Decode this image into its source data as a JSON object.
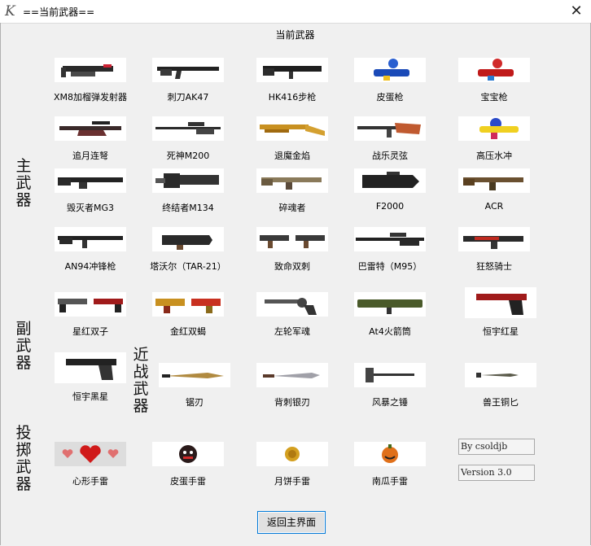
{
  "window": {
    "title": "==当前武器==",
    "icon": "k-logo-icon",
    "close_label": "✕"
  },
  "heading": "当前武器",
  "categories": {
    "primary": "主武器",
    "secondary": "副武器",
    "melee": "近战武器",
    "throwable": "投掷武器"
  },
  "primary": [
    {
      "label": "XM8加榴弹发射器",
      "icon": "grenade-launcher-rifle-icon"
    },
    {
      "label": "刺刀AK47",
      "icon": "ak47-icon"
    },
    {
      "label": "HK416步枪",
      "icon": "hk416-icon"
    },
    {
      "label": "皮蛋枪",
      "icon": "toy-gun-blue-icon"
    },
    {
      "label": "宝宝枪",
      "icon": "toy-gun-red-icon"
    },
    {
      "label": "追月连弩",
      "icon": "crossbow-icon"
    },
    {
      "label": "死神M200",
      "icon": "sniper-m200-icon"
    },
    {
      "label": "退魔金焰",
      "icon": "golden-shotgun-icon"
    },
    {
      "label": "战乐灵弦",
      "icon": "guitar-gun-icon"
    },
    {
      "label": "高压水冲",
      "icon": "water-gun-icon"
    },
    {
      "label": "毁灭者MG3",
      "icon": "mg3-icon"
    },
    {
      "label": "终结者M134",
      "icon": "minigun-icon"
    },
    {
      "label": "碎魂者",
      "icon": "rifle-tan-icon"
    },
    {
      "label": "F2000",
      "icon": "f2000-icon"
    },
    {
      "label": "ACR",
      "icon": "acr-icon"
    },
    {
      "label": "AN94冲锋枪",
      "icon": "an94-icon"
    },
    {
      "label": "塔沃尔（TAR-21）",
      "icon": "tar21-icon"
    },
    {
      "label": "致命双刺",
      "icon": "dual-smg-icon"
    },
    {
      "label": "巴雷特（M95）",
      "icon": "barrett-icon"
    },
    {
      "label": "狂怒骑士",
      "icon": "smg-red-icon"
    }
  ],
  "secondary": [
    {
      "label": "星红双子",
      "icon": "dual-pistol-icon"
    },
    {
      "label": "金红双蝎",
      "icon": "dual-scorpion-icon"
    },
    {
      "label": "左轮军魂",
      "icon": "revolver-icon"
    },
    {
      "label": "At4火箭筒",
      "icon": "rocket-launcher-icon"
    },
    {
      "label": "恒宇红星",
      "icon": "red-pistol-icon"
    },
    {
      "label": "恒宇黑星",
      "icon": "black-pistol-icon"
    }
  ],
  "melee": [
    {
      "label": "锯刃",
      "icon": "serrated-blade-icon"
    },
    {
      "label": "背刺银刃",
      "icon": "silver-knife-icon"
    },
    {
      "label": "风暴之锤",
      "icon": "hammer-icon"
    },
    {
      "label": "兽王铜匕",
      "icon": "bronze-dagger-icon"
    }
  ],
  "throwable": [
    {
      "label": "心形手雷",
      "icon": "heart-grenade-icon"
    },
    {
      "label": "皮蛋手雷",
      "icon": "egg-grenade-icon"
    },
    {
      "label": "月饼手雷",
      "icon": "mooncake-grenade-icon"
    },
    {
      "label": "南瓜手雷",
      "icon": "pumpkin-grenade-icon"
    }
  ],
  "info": {
    "author": "By csoldjb",
    "version": "Version 3.0"
  },
  "back_button": "返回主界面"
}
